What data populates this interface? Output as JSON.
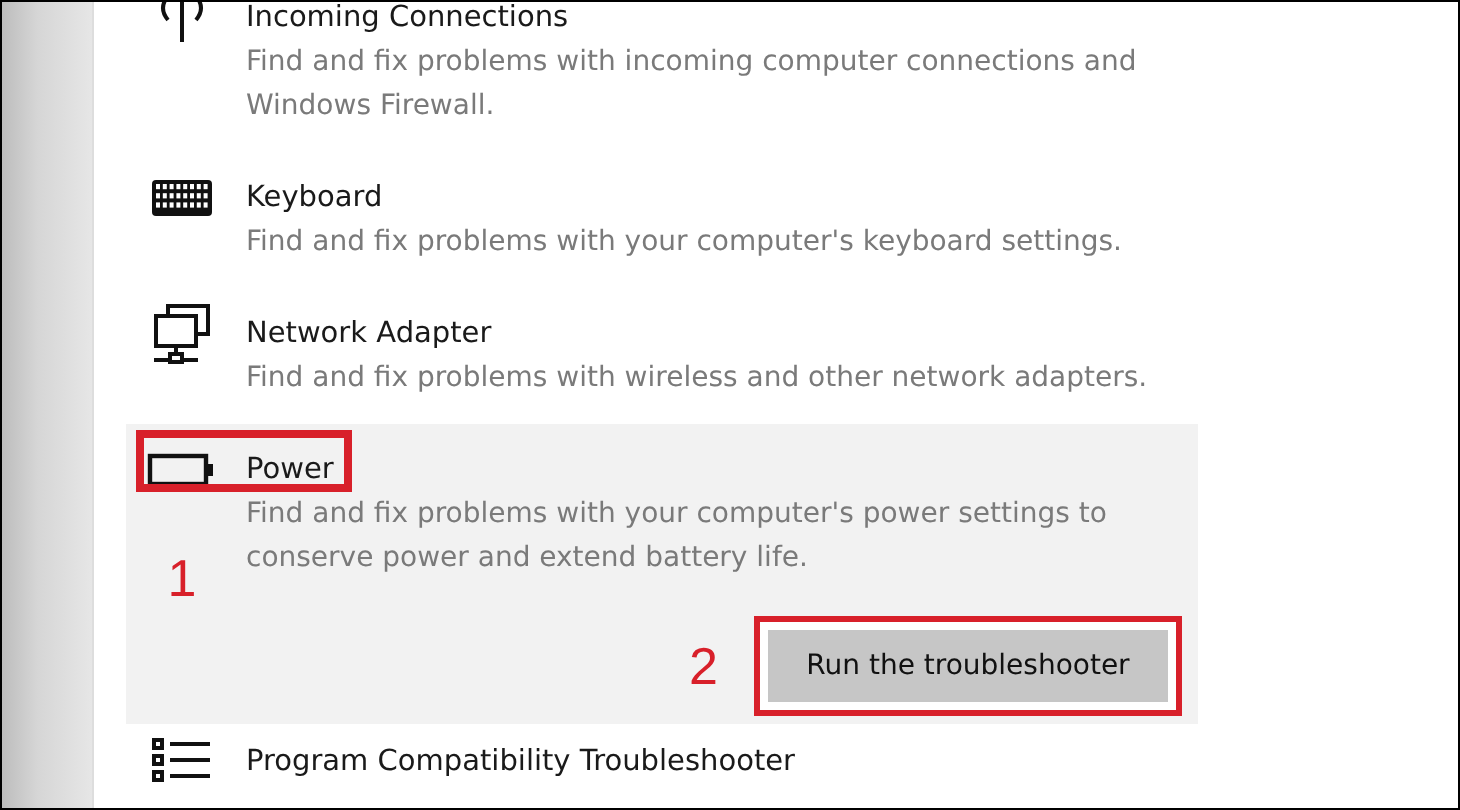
{
  "items": [
    {
      "kind": "antenna",
      "title": "Incoming Connections",
      "description": "Find and fix problems with incoming computer connections and Windows Firewall.",
      "selected": false
    },
    {
      "kind": "keyboard",
      "title": "Keyboard",
      "description": "Find and fix problems with your computer's keyboard settings.",
      "selected": false
    },
    {
      "kind": "network",
      "title": "Network Adapter",
      "description": "Find and fix problems with wireless and other network adapters.",
      "selected": false
    },
    {
      "kind": "battery",
      "title": "Power",
      "description": "Find and fix problems with your computer's power settings to conserve power and extend battery life.",
      "selected": true,
      "callout": "1",
      "button": {
        "label": "Run the troubleshooter",
        "callout": "2"
      }
    },
    {
      "kind": "list",
      "title": "Program Compatibility Troubleshooter",
      "selected": false
    }
  ]
}
